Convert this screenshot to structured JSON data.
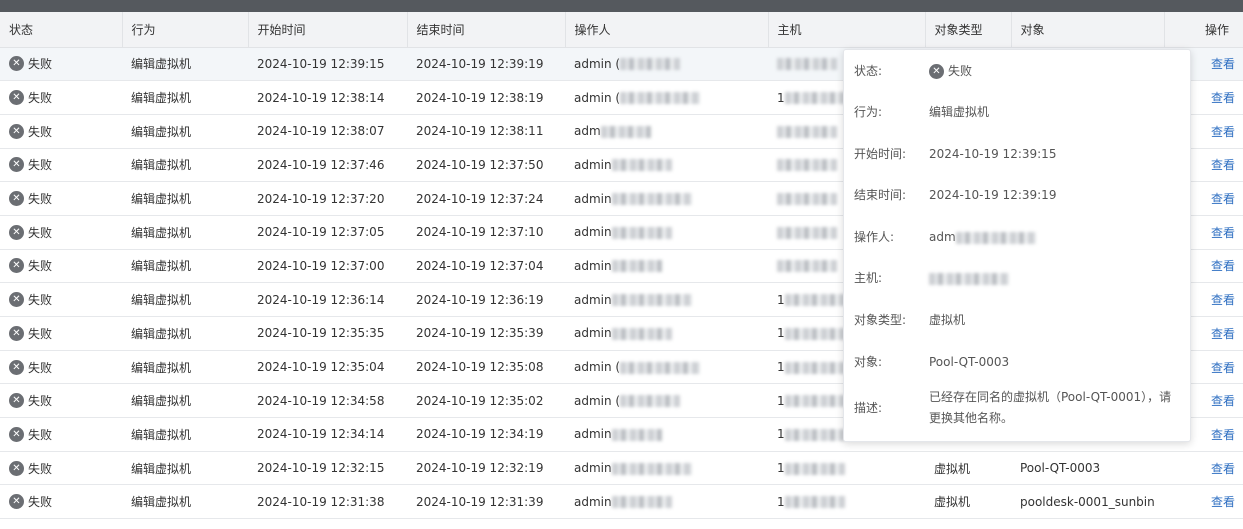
{
  "columns": {
    "status": "状态",
    "action": "行为",
    "start": "开始时间",
    "end": "结束时间",
    "operator": "操作人",
    "host": "主机",
    "object_type": "对象类型",
    "object": "对象",
    "ops": "操作"
  },
  "rows": [
    {
      "status": "失败",
      "action": "编辑虚拟机",
      "start": "2024-10-19 12:39:15",
      "end": "2024-10-19 12:39:19",
      "operator": "admin (",
      "host": "",
      "object_type": "",
      "object": "",
      "view": "查看"
    },
    {
      "status": "失败",
      "action": "编辑虚拟机",
      "start": "2024-10-19 12:38:14",
      "end": "2024-10-19 12:38:19",
      "operator": "admin (",
      "host": "1",
      "object_type": "",
      "object": "",
      "view": "查看"
    },
    {
      "status": "失败",
      "action": "编辑虚拟机",
      "start": "2024-10-19 12:38:07",
      "end": "2024-10-19 12:38:11",
      "operator": "adm",
      "host": "",
      "object_type": "",
      "object": "",
      "view": "查看"
    },
    {
      "status": "失败",
      "action": "编辑虚拟机",
      "start": "2024-10-19 12:37:46",
      "end": "2024-10-19 12:37:50",
      "operator": "admin",
      "host": "",
      "object_type": "",
      "object": "",
      "view": "查看"
    },
    {
      "status": "失败",
      "action": "编辑虚拟机",
      "start": "2024-10-19 12:37:20",
      "end": "2024-10-19 12:37:24",
      "operator": "admin",
      "host": "",
      "object_type": "",
      "object": "",
      "view": "查看"
    },
    {
      "status": "失败",
      "action": "编辑虚拟机",
      "start": "2024-10-19 12:37:05",
      "end": "2024-10-19 12:37:10",
      "operator": "admin",
      "host": "",
      "object_type": "",
      "object": "",
      "view": "查看"
    },
    {
      "status": "失败",
      "action": "编辑虚拟机",
      "start": "2024-10-19 12:37:00",
      "end": "2024-10-19 12:37:04",
      "operator": "admin",
      "host": "",
      "object_type": "",
      "object": "",
      "view": "查看"
    },
    {
      "status": "失败",
      "action": "编辑虚拟机",
      "start": "2024-10-19 12:36:14",
      "end": "2024-10-19 12:36:19",
      "operator": "admin",
      "host": "1",
      "object_type": "",
      "object": "",
      "view": "查看"
    },
    {
      "status": "失败",
      "action": "编辑虚拟机",
      "start": "2024-10-19 12:35:35",
      "end": "2024-10-19 12:35:39",
      "operator": "admin",
      "host": "1",
      "object_type": "",
      "object": "",
      "view": "查看"
    },
    {
      "status": "失败",
      "action": "编辑虚拟机",
      "start": "2024-10-19 12:35:04",
      "end": "2024-10-19 12:35:08",
      "operator": "admin (",
      "host": "1",
      "object_type": "",
      "object": "",
      "view": "查看"
    },
    {
      "status": "失败",
      "action": "编辑虚拟机",
      "start": "2024-10-19 12:34:58",
      "end": "2024-10-19 12:35:02",
      "operator": "admin (",
      "host": "1",
      "object_type": "",
      "object": "",
      "view": "查看"
    },
    {
      "status": "失败",
      "action": "编辑虚拟机",
      "start": "2024-10-19 12:34:14",
      "end": "2024-10-19 12:34:19",
      "operator": "admin",
      "host": "1",
      "object_type": "",
      "object": "",
      "view": "查看"
    },
    {
      "status": "失败",
      "action": "编辑虚拟机",
      "start": "2024-10-19 12:32:15",
      "end": "2024-10-19 12:32:19",
      "operator": "admin",
      "host": "1",
      "object_type": "虚拟机",
      "object": "Pool-QT-0003",
      "view": "查看"
    },
    {
      "status": "失败",
      "action": "编辑虚拟机",
      "start": "2024-10-19 12:31:38",
      "end": "2024-10-19 12:31:39",
      "operator": "admin",
      "host": "1",
      "object_type": "虚拟机",
      "object": "pooldesk-0001_sunbin",
      "view": "查看"
    }
  ],
  "detail": {
    "status_label": "状态:",
    "status_value": "失败",
    "action_label": "行为:",
    "action_value": "编辑虚拟机",
    "start_label": "开始时间:",
    "start_value": "2024-10-19 12:39:15",
    "end_label": "结束时间:",
    "end_value": "2024-10-19 12:39:19",
    "operator_label": "操作人:",
    "operator_value": "adm",
    "host_label": "主机:",
    "objtype_label": "对象类型:",
    "objtype_value": "虚拟机",
    "object_label": "对象:",
    "object_value": "Pool-QT-0003",
    "desc_label": "描述:",
    "desc_line1": "已经存在同名的虚拟机（Pool-QT-0001），请",
    "desc_line2": "更换其他名称。"
  },
  "icons": {
    "status_icon": "close-circle-icon"
  },
  "colors": {
    "link": "#2f6fc2",
    "fail_icon": "#6b6e73",
    "header_bg": "#f2f3f5"
  }
}
